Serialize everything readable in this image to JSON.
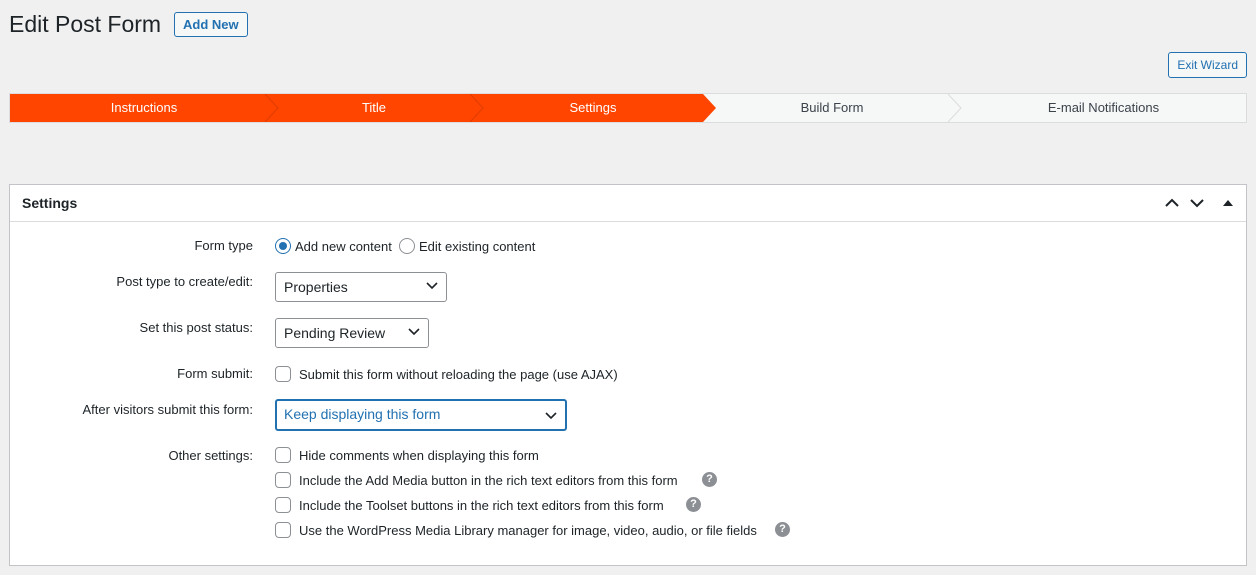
{
  "page": {
    "title": "Edit Post Form",
    "add_new_label": "Add New",
    "exit_wizard_label": "Exit Wizard"
  },
  "wizard": {
    "active_color": "#ff4500",
    "steps": [
      {
        "label": "Instructions",
        "completed": true
      },
      {
        "label": "Title",
        "completed": true
      },
      {
        "label": "Settings",
        "completed": true
      },
      {
        "label": "Build Form",
        "completed": false
      },
      {
        "label": "E-mail Notifications",
        "completed": false
      }
    ]
  },
  "panel": {
    "title": "Settings",
    "header_icons": [
      "chevron-up-icon",
      "chevron-down-icon",
      "collapse-triangle-icon"
    ],
    "rows": {
      "form_type": {
        "label": "Form type",
        "options": [
          {
            "label": "Add new content",
            "checked": true
          },
          {
            "label": "Edit existing content",
            "checked": false
          }
        ]
      },
      "post_type": {
        "label": "Post type to create/edit:",
        "value": "Properties"
      },
      "post_status": {
        "label": "Set this post status:",
        "value": "Pending Review"
      },
      "form_submit": {
        "label": "Form submit:",
        "checkbox_label": "Submit this form without reloading the page (use AJAX)",
        "checked": false
      },
      "after_submit": {
        "label": "After visitors submit this form:",
        "value": "Keep displaying this form"
      },
      "other_settings": {
        "label": "Other settings:",
        "options": [
          {
            "label": "Hide comments when displaying this form",
            "checked": false,
            "help": false
          },
          {
            "label": "Include the Add Media button in the rich text editors from this form",
            "checked": false,
            "help": true
          },
          {
            "label": "Include the Toolset buttons in the rich text editors from this form",
            "checked": false,
            "help": true
          },
          {
            "label": "Use the WordPress Media Library manager for image, video, audio, or file fields",
            "checked": false,
            "help": true
          }
        ]
      }
    }
  },
  "help_glyph": "?"
}
